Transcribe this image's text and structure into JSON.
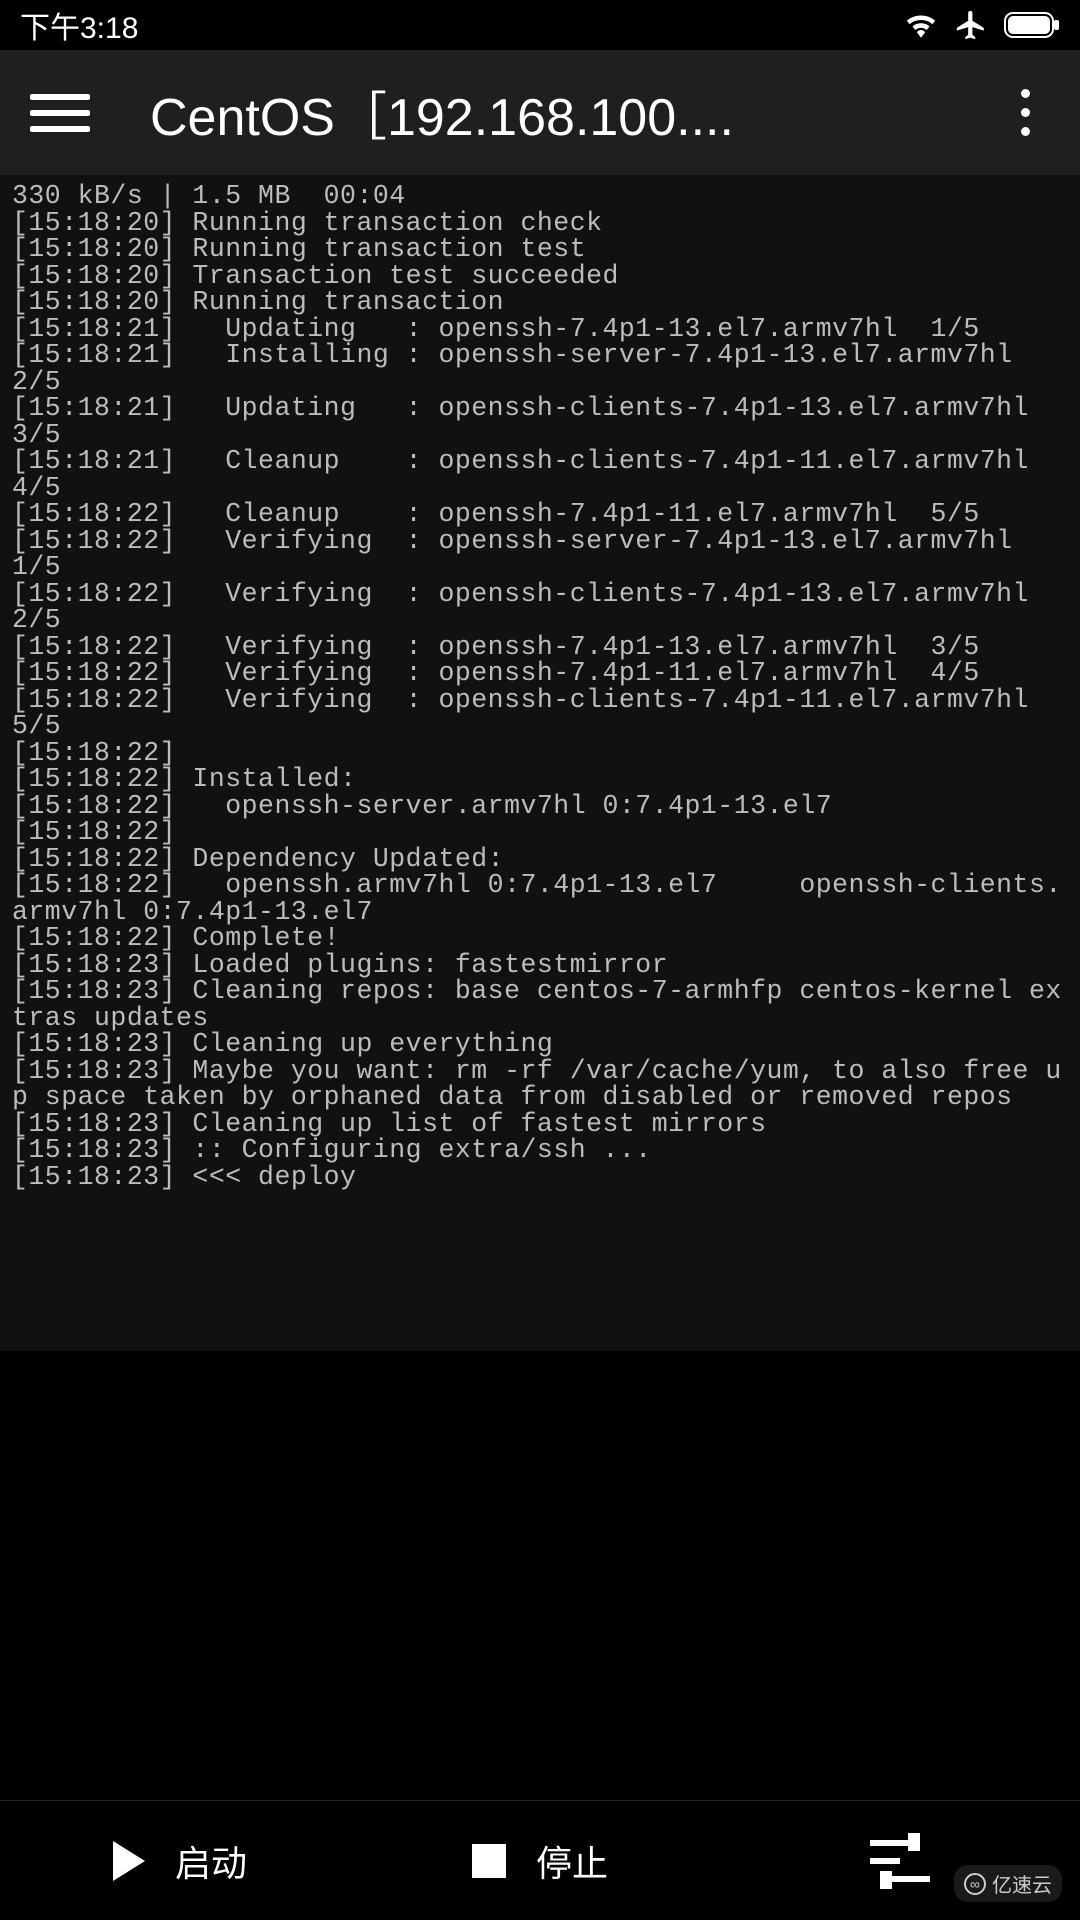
{
  "status": {
    "time": "下午3:18",
    "wifi": true,
    "airplane": true,
    "battery": true
  },
  "appbar": {
    "title": "CentOS［192.168.100...."
  },
  "terminal_text": "330 kB/s | 1.5 MB  00:04\n[15:18:20] Running transaction check\n[15:18:20] Running transaction test\n[15:18:20] Transaction test succeeded\n[15:18:20] Running transaction\n[15:18:21]   Updating   : openssh-7.4p1-13.el7.armv7hl  1/5\n[15:18:21]   Installing : openssh-server-7.4p1-13.el7.armv7hl                         2/5\n[15:18:21]   Updating   : openssh-clients-7.4p1-13.el7.armv7hl                        3/5\n[15:18:21]   Cleanup    : openssh-clients-7.4p1-11.el7.armv7hl                        4/5\n[15:18:22]   Cleanup    : openssh-7.4p1-11.el7.armv7hl  5/5\n[15:18:22]   Verifying  : openssh-server-7.4p1-13.el7.armv7hl                         1/5\n[15:18:22]   Verifying  : openssh-clients-7.4p1-13.el7.armv7hl                        2/5\n[15:18:22]   Verifying  : openssh-7.4p1-13.el7.armv7hl  3/5\n[15:18:22]   Verifying  : openssh-7.4p1-11.el7.armv7hl  4/5\n[15:18:22]   Verifying  : openssh-clients-7.4p1-11.el7.armv7hl                        5/5\n[15:18:22]\n[15:18:22] Installed:\n[15:18:22]   openssh-server.armv7hl 0:7.4p1-13.el7\n[15:18:22]\n[15:18:22] Dependency Updated:\n[15:18:22]   openssh.armv7hl 0:7.4p1-13.el7     openssh-clients.armv7hl 0:7.4p1-13.el7\n[15:18:22] Complete!\n[15:18:23] Loaded plugins: fastestmirror\n[15:18:23] Cleaning repos: base centos-7-armhfp centos-kernel extras updates\n[15:18:23] Cleaning up everything\n[15:18:23] Maybe you want: rm -rf /var/cache/yum, to also free up space taken by orphaned data from disabled or removed repos\n[15:18:23] Cleaning up list of fastest mirrors\n[15:18:23] :: Configuring extra/ssh ...\n[15:18:23] <<< deploy",
  "bottom": {
    "start": "启动",
    "stop": "停止"
  },
  "watermark": {
    "text": "亿速云",
    "icon": "∞"
  }
}
